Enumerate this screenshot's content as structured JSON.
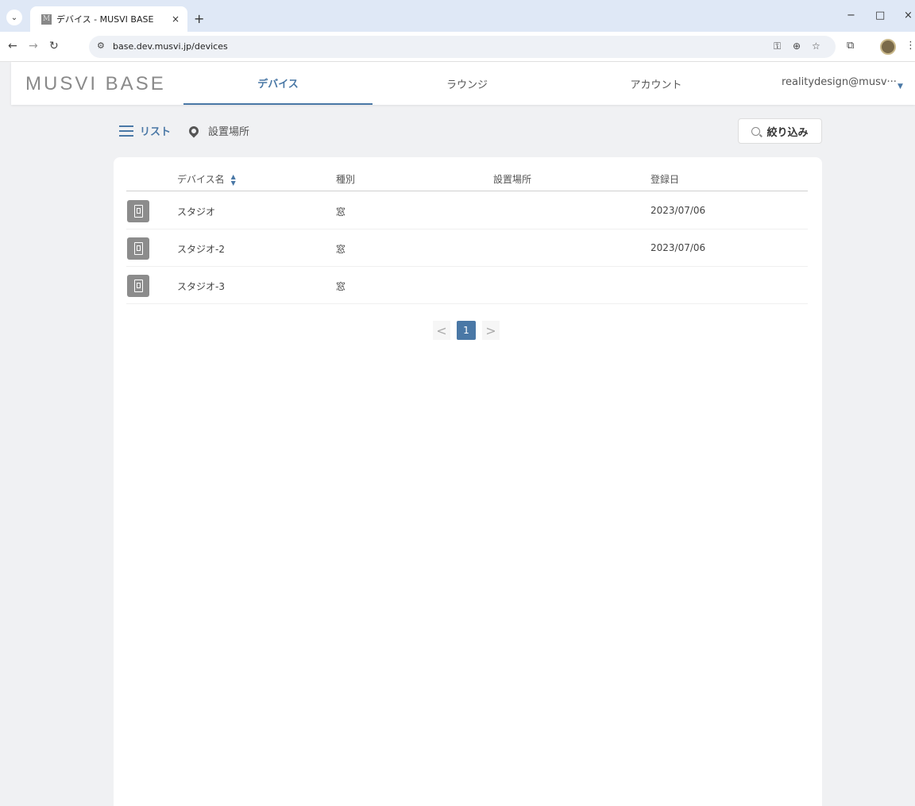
{
  "browser": {
    "tab_title": "デバイス - MUSVI BASE",
    "favicon_letter": "M",
    "new_tab": "+",
    "url": "base.dev.musvi.jp/devices",
    "minimize": "−",
    "maximize": "□",
    "close": "×",
    "tab_close": "×"
  },
  "app": {
    "logo": "MUSVI BASE",
    "nav": [
      {
        "label": "デバイス"
      },
      {
        "label": "ラウンジ"
      },
      {
        "label": "アカウント"
      }
    ],
    "user": "realitydesign@musv···"
  },
  "toolbar": {
    "list_label": "リスト",
    "location_label": "設置場所",
    "filter_label": "絞り込み"
  },
  "table": {
    "headers": {
      "name": "デバイス名",
      "type": "種別",
      "location": "設置場所",
      "registered": "登録日"
    },
    "rows": [
      {
        "name": "スタジオ",
        "type": "窓",
        "location": "",
        "registered": "2023/07/06"
      },
      {
        "name": "スタジオ-2",
        "type": "窓",
        "location": "",
        "registered": "2023/07/06"
      },
      {
        "name": "スタジオ-3",
        "type": "窓",
        "location": "",
        "registered": ""
      }
    ]
  },
  "pagination": {
    "prev": "<",
    "current": "1",
    "next": ">"
  },
  "colors": {
    "accent": "#4a78a6",
    "background": "#f0f1f3",
    "device_icon": "#8c8c8c"
  }
}
